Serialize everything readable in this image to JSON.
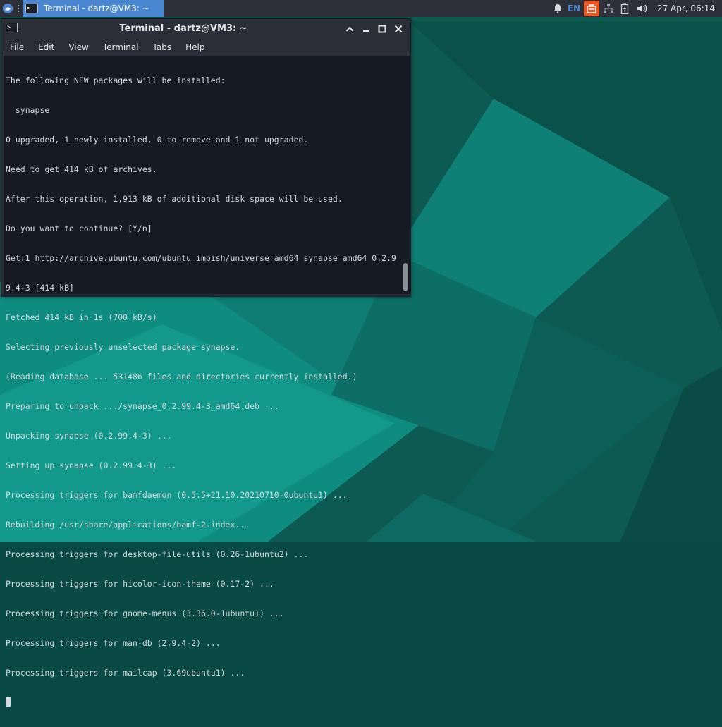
{
  "panel": {
    "taskbar_title": "Terminal - dartz@VM3: ~",
    "keyboard_layout": "EN",
    "clock": "27 Apr, 06:14",
    "icons": [
      "whisker-menu-icon",
      "terminal-app-icon",
      "notification-bell-icon",
      "ubuntu-updates-icon",
      "network-icon",
      "battery-icon",
      "volume-icon"
    ]
  },
  "terminal": {
    "title": "Terminal - dartz@VM3: ~",
    "menu": [
      "File",
      "Edit",
      "View",
      "Terminal",
      "Tabs",
      "Help"
    ],
    "lines": [
      "The following NEW packages will be installed:",
      "  synapse",
      "0 upgraded, 1 newly installed, 0 to remove and 1 not upgraded.",
      "Need to get 414 kB of archives.",
      "After this operation, 1,913 kB of additional disk space will be used.",
      "Do you want to continue? [Y/n]",
      "Get:1 http://archive.ubuntu.com/ubuntu impish/universe amd64 synapse amd64 0.2.9",
      "9.4-3 [414 kB]",
      "Fetched 414 kB in 1s (700 kB/s)",
      "Selecting previously unselected package synapse.",
      "(Reading database ... 531486 files and directories currently installed.)",
      "Preparing to unpack .../synapse_0.2.99.4-3_amd64.deb ...",
      "Unpacking synapse (0.2.99.4-3) ...",
      "Setting up synapse (0.2.99.4-3) ...",
      "Processing triggers for bamfdaemon (0.5.5+21.10.20210710-0ubuntu1) ...",
      "Rebuilding /usr/share/applications/bamf-2.index...",
      "Processing triggers for desktop-file-utils (0.26-1ubuntu2) ...",
      "Processing triggers for hicolor-icon-theme (0.17-2) ...",
      "Processing triggers for gnome-menus (3.36.0-1ubuntu1) ...",
      "Processing triggers for man-db (2.9.4-2) ...",
      "Processing triggers for mailcap (3.69ubuntu1) ..."
    ]
  },
  "colors": {
    "panel_bg": "#2d3038",
    "active_task": "#4a86cf",
    "terminal_bg": "#161a25",
    "terminal_text": "#d6d8dd",
    "ubuntu_orange": "#e95420"
  }
}
